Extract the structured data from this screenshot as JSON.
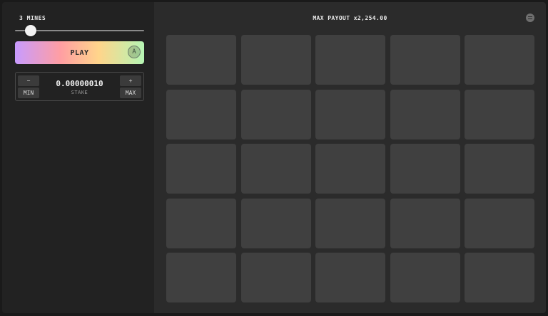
{
  "sidebar": {
    "mines_label": "3 MINES",
    "mines_count": 3,
    "play_label": "PLAY",
    "auto_icon_letter": "A",
    "stake": {
      "minus": "−",
      "plus": "+",
      "min": "MIN",
      "max": "MAX",
      "value": "0.00000010",
      "label": "STAKE"
    }
  },
  "board": {
    "payout_text": "MAX PAYOUT x2,254.00",
    "rows": 5,
    "columns": 5
  },
  "icons": {
    "menu": "menu-icon",
    "auto": "auto-play-icon"
  },
  "colors": {
    "tile": "#404040",
    "board_bg": "#2b2b2b",
    "sidebar_bg": "#222222"
  }
}
